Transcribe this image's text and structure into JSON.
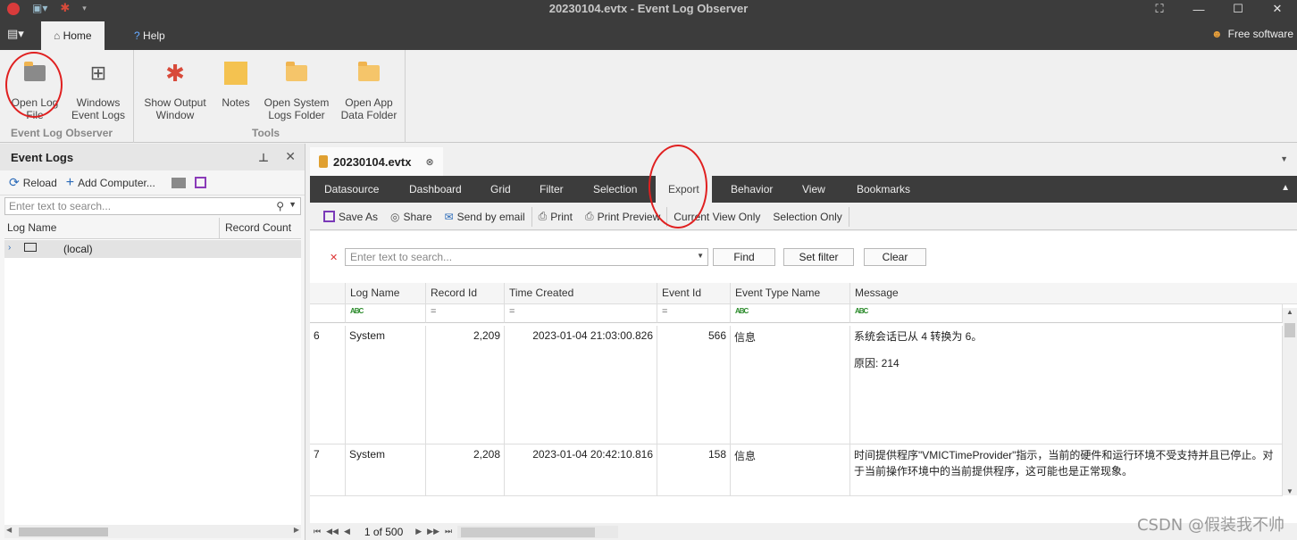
{
  "titlebar": {
    "title": "20230104.evtx - Event Log Observer"
  },
  "ribbon": {
    "tabs": [
      "Home",
      "Help"
    ],
    "user_label": "Free software",
    "buttons": {
      "open_log": [
        "Open Log",
        "File"
      ],
      "windows_logs": [
        "Windows",
        "Event Logs"
      ],
      "show_output": [
        "Show Output",
        "Window"
      ],
      "notes": [
        "Notes"
      ],
      "open_system": [
        "Open System",
        "Logs Folder"
      ],
      "open_app": [
        "Open App",
        "Data Folder"
      ]
    },
    "groups": {
      "main": "Event Log Observer",
      "tools": "Tools"
    }
  },
  "left_panel": {
    "title": "Event Logs",
    "toolbar": {
      "reload": "Reload",
      "add_computer": "Add Computer..."
    },
    "search_placeholder": "Enter text to search...",
    "columns": [
      "Log Name",
      "Record Count"
    ],
    "rows": [
      {
        "name": "(local)"
      }
    ]
  },
  "document": {
    "tab_title": "20230104.evtx",
    "inner_tabs": [
      "Datasource",
      "Dashboard",
      "Grid",
      "Filter",
      "Selection",
      "Export",
      "Behavior",
      "View",
      "Bookmarks"
    ],
    "export_actions": {
      "save_as": "Save As",
      "share": "Share",
      "send_email": "Send by email",
      "print": "Print",
      "print_preview": "Print Preview",
      "current_view": "Current View Only",
      "selection_only": "Selection Only"
    },
    "filter": {
      "placeholder": "Enter text to search...",
      "find": "Find",
      "set_filter": "Set filter",
      "clear": "Clear"
    },
    "grid": {
      "columns": [
        "Log Name",
        "Record Id",
        "Time Created",
        "Event Id",
        "Event Type Name",
        "Message"
      ],
      "rows": [
        {
          "idx": "6",
          "log": "System",
          "record": "2,209",
          "time": "2023-01-04 21:03:00.826",
          "event": "566",
          "type": "信息",
          "msg1": "系统会话已从 4 转换为 6。",
          "msg2": "原因: 214"
        },
        {
          "idx": "7",
          "log": "System",
          "record": "2,208",
          "time": "2023-01-04 20:42:10.816",
          "event": "158",
          "type": "信息",
          "msg1": "时间提供程序\"VMICTimeProvider\"指示，当前的硬件和运行环境不受支持并且已停止。对于当前操作环境中的当前提供程序，这可能也是正常现象。",
          "msg2": ""
        }
      ]
    },
    "pager": {
      "text": "1 of 500"
    }
  },
  "watermark": "CSDN @假装我不帅"
}
